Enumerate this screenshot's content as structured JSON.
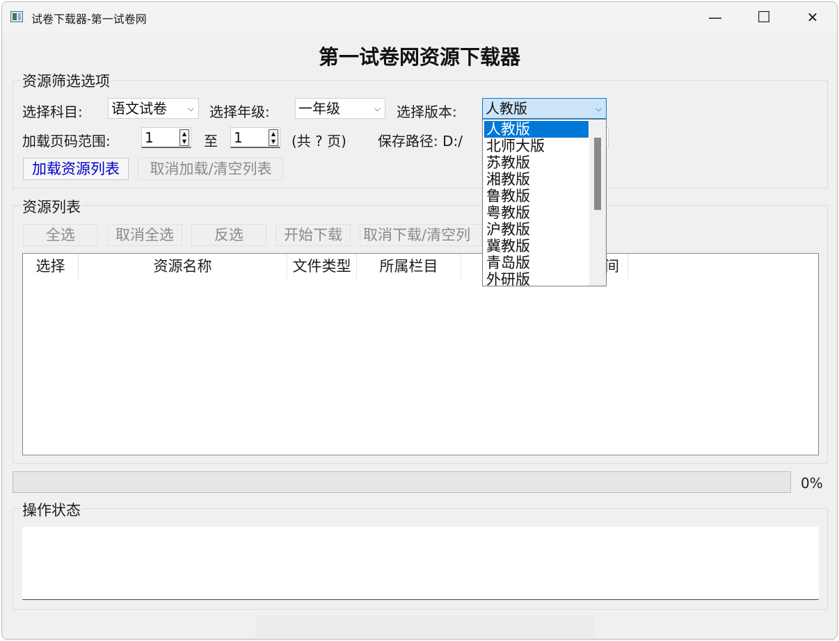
{
  "window": {
    "title": "试卷下载器-第一试卷网",
    "minimize": "—",
    "maximize": "☐",
    "close": "✕"
  },
  "heading": "第一试卷网资源下载器",
  "filter": {
    "group_label": "资源筛选选项",
    "subject_label": "选择科目:",
    "subject_value": "语文试卷",
    "grade_label": "选择年级:",
    "grade_value": "一年级",
    "edition_label": "选择版本:",
    "edition_value": "人教版",
    "page_range_label": "加载页码范围:",
    "page_from": "1",
    "to_label": "至",
    "page_to": "1",
    "total_pages": "(共 ? 页)",
    "save_path_label": "保存路径: D:/",
    "load_button": "加载资源列表",
    "cancel_button": "取消加载/清空列表"
  },
  "resources": {
    "group_label": "资源列表",
    "select_all": "全选",
    "deselect_all": "取消全选",
    "invert": "反选",
    "start_download": "开始下载",
    "cancel_download": "取消下载/清空列",
    "columns": [
      "选择",
      "资源名称",
      "文件类型",
      "所属栏目",
      "",
      "间"
    ]
  },
  "progress": {
    "value": 0,
    "label": "0%"
  },
  "status": {
    "group_label": "操作状态"
  },
  "edition_dropdown": {
    "options": [
      "人教版",
      "北师大版",
      "苏教版",
      "湘教版",
      "鲁教版",
      "粤教版",
      "沪教版",
      "冀教版",
      "青岛版",
      "外研版"
    ],
    "selected_index": 0
  },
  "icons": {
    "arrow": "⌵",
    "spin_up": "▲",
    "spin_down": "▼"
  },
  "colors": {
    "accent": "#0078d7",
    "link_blue": "#0000cc",
    "disabled_text": "#8a8a8a"
  }
}
